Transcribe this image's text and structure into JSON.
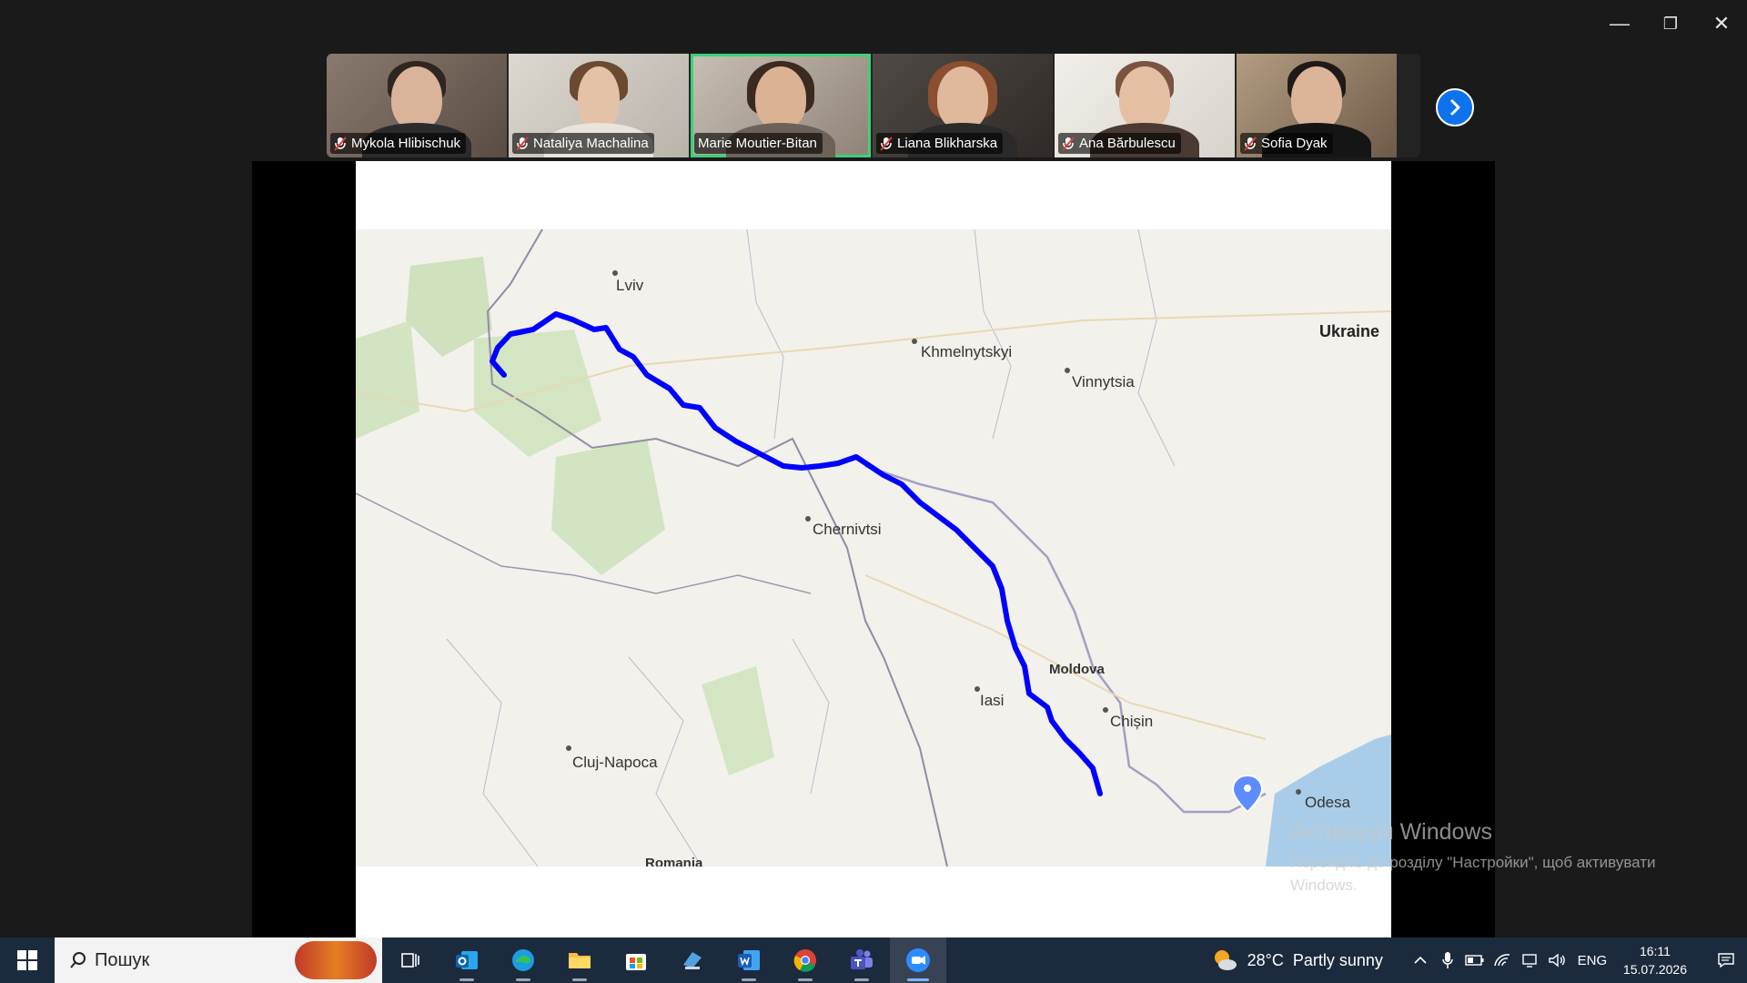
{
  "window_controls": {
    "minimize": "—",
    "restore": "❐",
    "close": "✕"
  },
  "participants": [
    {
      "name": "Mykola Hlibischuk",
      "muted": true,
      "active": false
    },
    {
      "name": "Nataliya Machalina",
      "muted": true,
      "active": false
    },
    {
      "name": "Marie Moutier-Bitan",
      "muted": false,
      "active": true
    },
    {
      "name": "Liana Blikharska",
      "muted": true,
      "active": false
    },
    {
      "name": "Ana Bărbulescu",
      "muted": true,
      "active": false
    },
    {
      "name": "Sofia Dyak",
      "muted": true,
      "active": false
    }
  ],
  "map": {
    "labels": {
      "lviv": "Lviv",
      "khmelnytskyi": "Khmelnytskyi",
      "vinnytsia": "Vinnytsia",
      "ukraine": "Ukraine",
      "chernivtsi": "Chernivtsi",
      "moldova": "Moldova",
      "iasi": "Iasi",
      "chisinau": "Chișin",
      "cluj": "Cluj-Napoca",
      "odesa": "Odesa",
      "romania": "Romania"
    },
    "route_color": "#0000ff"
  },
  "watermark": {
    "title": "Активація Windows",
    "subtitle": "Перейдіть до розділу \"Настройки\", щоб активувати Windows."
  },
  "taskbar": {
    "search_placeholder": "Пошук",
    "apps": [
      "task-view",
      "outlook",
      "edge",
      "file-explorer",
      "microsoft-store",
      "remote-desktop",
      "word",
      "chrome",
      "teams",
      "zoom"
    ],
    "weather": {
      "temp": "28°C",
      "condition": "Partly sunny"
    },
    "language": "ENG",
    "time": "16:11",
    "date": "15.07.2026"
  }
}
